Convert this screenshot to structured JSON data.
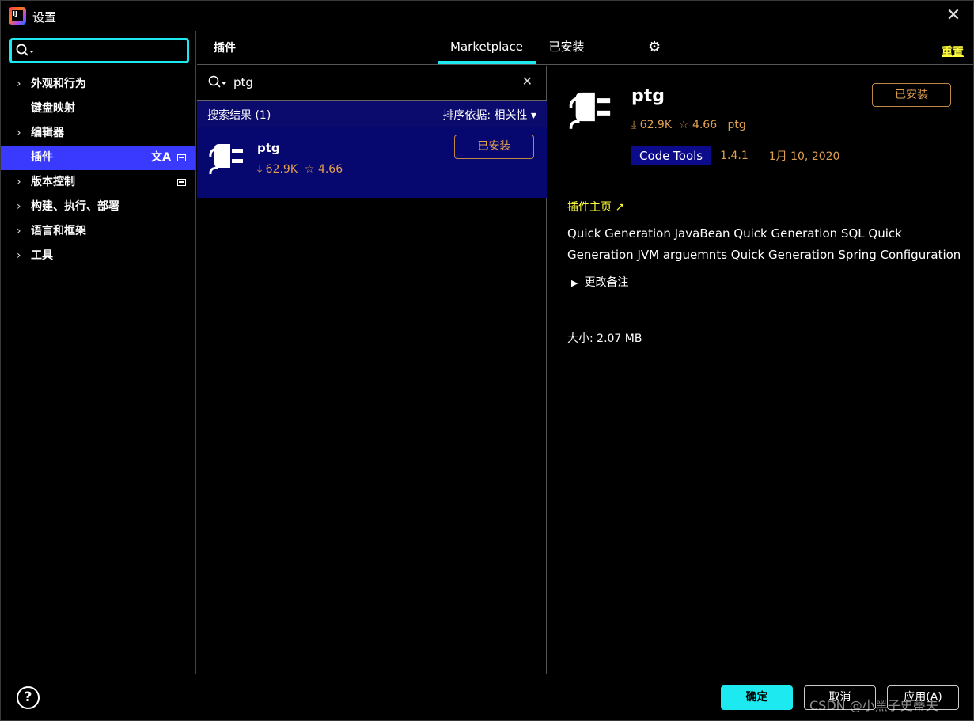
{
  "window": {
    "title": "设置"
  },
  "sidebar": {
    "search_value": "",
    "items": [
      {
        "label": "外观和行为",
        "expandable": true
      },
      {
        "label": "键盘映射",
        "expandable": false
      },
      {
        "label": "编辑器",
        "expandable": true
      },
      {
        "label": "插件",
        "expandable": false,
        "selected": true
      },
      {
        "label": "版本控制",
        "expandable": true
      },
      {
        "label": "构建、执行、部署",
        "expandable": true
      },
      {
        "label": "语言和框架",
        "expandable": true
      },
      {
        "label": "工具",
        "expandable": true
      }
    ]
  },
  "header": {
    "title": "插件",
    "tabs": [
      {
        "label": "Marketplace",
        "active": true
      },
      {
        "label": "已安装",
        "active": false
      }
    ],
    "reset_label": "重置"
  },
  "list": {
    "search_value": "ptg",
    "results_label": "搜索结果 (1)",
    "sort_label": "排序依据: 相关性 ▾",
    "items": [
      {
        "name": "ptg",
        "downloads": "62.9K",
        "rating": "4.66",
        "button": "已安装"
      }
    ]
  },
  "detail": {
    "name": "ptg",
    "downloads": "62.9K",
    "rating": "4.66",
    "vendor": "ptg",
    "install_button": "已安装",
    "category": "Code Tools",
    "version": "1.4.1",
    "date": "1月 10, 2020",
    "homepage_label": "插件主页 ↗",
    "description": "Quick Generation JavaBean Quick Generation SQL Quick Generation JVM arguemnts Quick Generation Spring Configuration",
    "changes_label": "更改备注",
    "size": "大小: 2.07 MB"
  },
  "footer": {
    "help": "?",
    "ok": "确定",
    "cancel": "取消",
    "apply": "应用(A)",
    "watermark": "CSDN @小黑子史蒂夫"
  },
  "colors": {
    "accent": "#1de9f0",
    "selection": "#3a3aff",
    "result_bg": "#070770",
    "link": "#ffff3b",
    "meta": "#e0a050"
  }
}
